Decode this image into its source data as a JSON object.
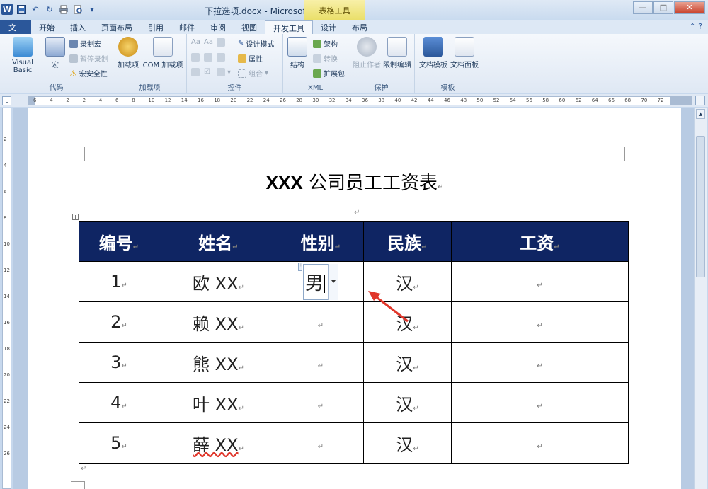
{
  "window": {
    "title": "下拉选项.docx - Microsoft Word",
    "contextual_group": "表格工具",
    "app_logo": "W",
    "minimize": "—",
    "maximize": "□",
    "close": "✕"
  },
  "tabs": [
    "文件",
    "开始",
    "插入",
    "页面布局",
    "引用",
    "邮件",
    "审阅",
    "视图",
    "开发工具",
    "设计",
    "布局"
  ],
  "active_tab": "开发工具",
  "ribbon": {
    "code": {
      "label": "代码",
      "visual_basic": "Visual Basic",
      "macro": "宏",
      "record_macro": "录制宏",
      "pause_recording": "暂停录制",
      "macro_security": "宏安全性"
    },
    "addins": {
      "label": "加载项",
      "addin": "加载项",
      "com_addin": "COM 加载项"
    },
    "controls": {
      "label": "控件",
      "design_mode": "设计模式",
      "properties": "属性",
      "group": "组合"
    },
    "xml": {
      "label": "XML",
      "structure": "结构",
      "schema": "架构",
      "transform": "转换",
      "expansion_pack": "扩展包"
    },
    "protect": {
      "label": "保护",
      "block_authors": "阻止作者",
      "restrict_editing": "限制编辑"
    },
    "templates": {
      "label": "模板",
      "document_template": "文档模板",
      "document_panel": "文档面板"
    }
  },
  "ruler_ticks": [
    "6",
    "4",
    "2",
    "2",
    "4",
    "6",
    "8",
    "10",
    "12",
    "14",
    "16",
    "18",
    "20",
    "22",
    "24",
    "26",
    "28",
    "30",
    "32",
    "34",
    "36",
    "38",
    "40",
    "42",
    "44",
    "46",
    "48",
    "50",
    "52",
    "54",
    "56",
    "58",
    "60",
    "62",
    "64",
    "66",
    "68",
    "70",
    "72"
  ],
  "vruler_ticks": [
    "2",
    "4",
    "6",
    "8",
    "10",
    "12",
    "14",
    "16",
    "18",
    "20",
    "22",
    "24",
    "26"
  ],
  "document": {
    "title_bold": "XXX",
    "title_rest": " 公司员工工资表",
    "para_mark": "↵",
    "table": {
      "headers": [
        "编号",
        "姓名",
        "性别",
        "民族",
        "工资"
      ],
      "rows": [
        {
          "id": "1",
          "name": "欧 XX",
          "gender": "男",
          "ethnicity": "汉",
          "salary": ""
        },
        {
          "id": "2",
          "name": "赖 XX",
          "gender": "",
          "ethnicity": "汉",
          "salary": ""
        },
        {
          "id": "3",
          "name": "熊 XX",
          "gender": "",
          "ethnicity": "汉",
          "salary": ""
        },
        {
          "id": "4",
          "name": "叶 XX",
          "gender": "",
          "ethnicity": "汉",
          "salary": ""
        },
        {
          "id": "5",
          "name": "薛 XX",
          "gender": "",
          "ethnicity": "汉",
          "salary": ""
        }
      ]
    }
  },
  "colors": {
    "header_bg": "#0f2563",
    "file_tab": "#2b579a",
    "arrow": "#e0362a"
  }
}
